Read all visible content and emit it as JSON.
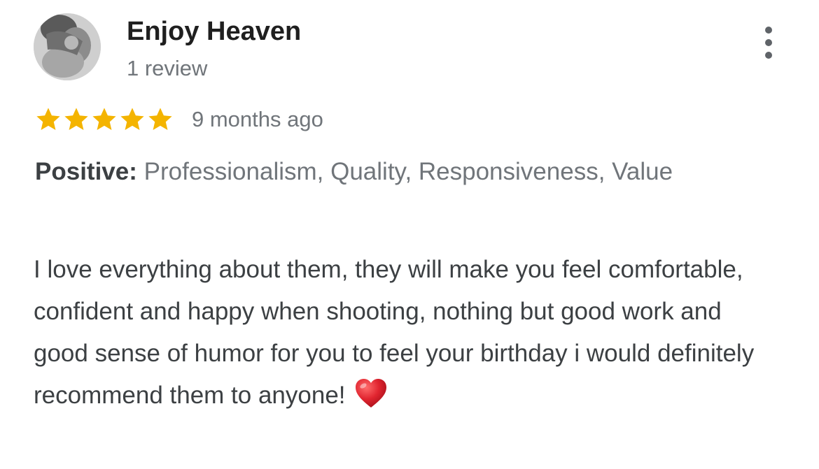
{
  "reviewer": {
    "name": "Enjoy Heaven",
    "review_count": "1 review"
  },
  "rating": {
    "stars": 5,
    "max_stars": 5,
    "star_color": "#F4B400",
    "time_ago": "9 months ago"
  },
  "highlights": {
    "label": "Positive:",
    "values": "Professionalism, Quality, Responsiveness, Value"
  },
  "review": {
    "text": "I love everything about them, they will make you feel comfortable, confident and happy when shooting, nothing but good work and good sense of humor for you to feel your birthday i would definitely recommend them to anyone!",
    "emoji_icon": "red-heart-icon"
  },
  "menu": {
    "icon": "more-vert-icon"
  },
  "colors": {
    "heart": "#E0242F",
    "secondary_text": "#70757a"
  }
}
